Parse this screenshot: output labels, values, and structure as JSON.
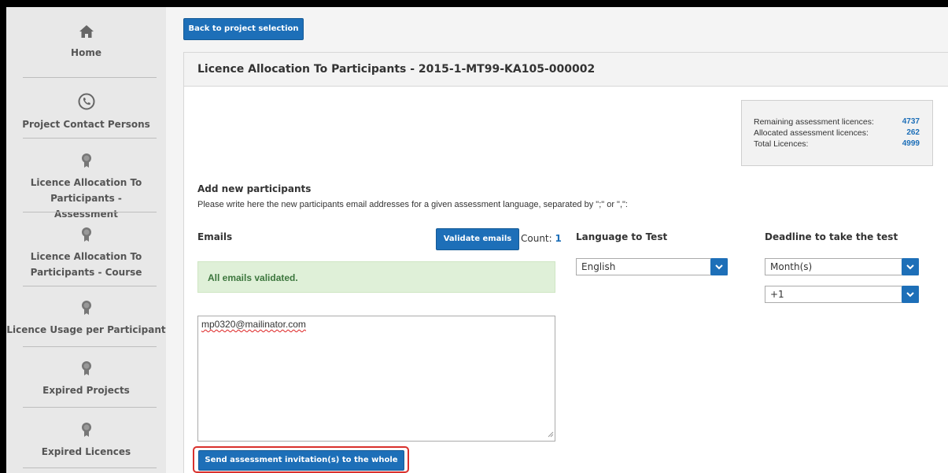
{
  "sidebar": {
    "items": [
      {
        "label": "Home",
        "icon": "home-icon"
      },
      {
        "label": "Project Contact Persons",
        "icon": "phone-icon"
      },
      {
        "label": "Licence Allocation To Participants - Assessment",
        "icon": "award-icon"
      },
      {
        "label": "Licence Allocation To Participants - Course",
        "icon": "award-icon"
      },
      {
        "label": "Licence Usage per Participant",
        "icon": "award-icon"
      },
      {
        "label": "Expired Projects",
        "icon": "award-icon"
      },
      {
        "label": "Expired Licences",
        "icon": "award-icon"
      }
    ]
  },
  "toolbar": {
    "back_label": "Back to project selection"
  },
  "panel": {
    "title": "Licence Allocation To Participants - 2015-1-MT99-KA105-000002"
  },
  "licences": {
    "remaining_label": "Remaining assessment licences:",
    "remaining_value": "4737",
    "allocated_label": "Allocated assessment licences:",
    "allocated_value": "262",
    "total_label": "Total Licences:",
    "total_value": "4999"
  },
  "add": {
    "title": "Add new participants",
    "description": "Please write here the new participants email addresses for a given assessment language, separated by \";\" or \",\":"
  },
  "emails": {
    "header": "Emails",
    "validate_label": "Validate emails",
    "count_label": "Count:",
    "count_value": "1",
    "alert": "All emails validated.",
    "value": "mp0320@mailinator.com"
  },
  "language": {
    "header": "Language to Test",
    "selected": "English"
  },
  "deadline": {
    "header": "Deadline to take the test",
    "unit_selected": "Month(s)",
    "amount_selected": "+1"
  },
  "send": {
    "label": "Send assessment invitation(s) to the whole list"
  },
  "colors": {
    "accent": "#1d6fb8",
    "alert_bg": "#dff0d8",
    "alert_text": "#3c763d",
    "highlight": "#d9302c"
  }
}
